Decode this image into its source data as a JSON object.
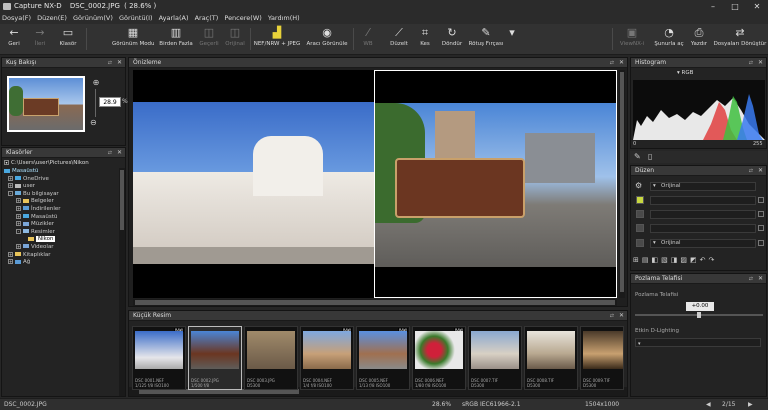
{
  "window": {
    "app": "Capture NX-D",
    "file": "DSC_0002.JPG",
    "zoom": "( 28.6% )"
  },
  "menu": [
    "Dosya(F)",
    "Düzen(E)",
    "Görünüm(V)",
    "Görüntü(I)",
    "Ayarla(A)",
    "Araç(T)",
    "Pencere(W)",
    "Yardım(H)"
  ],
  "toolbar": {
    "back": "Geri",
    "forward": "İleri",
    "folder": "Klasör",
    "view_mode": "Görünüm Modu",
    "multi": "Birden Fazla",
    "undo": "Geçerli",
    "original": "Orijinal",
    "nef": "NEF/NRW + JPEG",
    "image_view": "Aracı Görünüle",
    "wb": "WB",
    "straighten": "Düzelt",
    "crop": "Kes",
    "rotate": "Döndür",
    "retouch": "Rötuş Fırçası",
    "viewnx": "ViewNX-i",
    "convert": "Şunurla aç",
    "print": "Yazdır",
    "output": "Dosyaları Dönüştür"
  },
  "birdseye": {
    "title": "Kuş Bakışı",
    "zoom_value": "28.9"
  },
  "folders": {
    "title": "Klasörler",
    "path": "C:\\Users\\user\\Pictures\\Nikon",
    "items": [
      "Masaüstü",
      "OneDrive",
      "user",
      "Bu bilgisayar",
      "Belgeler",
      "İndirilenler",
      "Masaüstü",
      "Müzikler",
      "Resimler",
      "Nikon",
      "Videolar",
      "Kitaplıklar",
      "Ağ"
    ]
  },
  "viewer": {
    "title": "Önizleme"
  },
  "filmstrip": {
    "title": "Küçük Resim",
    "raw_tag": "RAW",
    "thumbs": [
      {
        "c1": "DSC 0001.NEF",
        "c2": "1/125 f/8 ISO100"
      },
      {
        "c1": "DSC 0002.JPG",
        "c2": "1/500 f/8"
      },
      {
        "c1": "DSC 0003.JPG",
        "c2": "D5300"
      },
      {
        "c1": "DSC 0004.NEF",
        "c2": "1/4 f/8 ISO100"
      },
      {
        "c1": "DSC 0005.NEF",
        "c2": "1/13 f/8 ISO100"
      },
      {
        "c1": "DSC 0006.NEF",
        "c2": "1/80 f/8 ISO100"
      },
      {
        "c1": "DSC 0007.TIF",
        "c2": "D5300"
      },
      {
        "c1": "DSC 0008.TIF",
        "c2": "D5300"
      },
      {
        "c1": "DSC 0009.TIF",
        "c2": "D5300"
      }
    ]
  },
  "histogram": {
    "title": "Histogram",
    "channel": "RGB",
    "min": "0",
    "max": "255"
  },
  "adjust": {
    "title": "Düzen",
    "original1": "Orijinal",
    "original2": "Orijinal"
  },
  "exposure": {
    "title": "Pozlama Telafisi",
    "label": "Pozlama Telafisi",
    "value": "+0.00",
    "dlighting": "Etkin D-Lighting"
  },
  "status": {
    "file": "DSC_0002.JPG",
    "zoom": "28.6%",
    "colorspace": "sRGB IEC61966-2.1",
    "size": "1504x1000",
    "page": "2/15"
  }
}
